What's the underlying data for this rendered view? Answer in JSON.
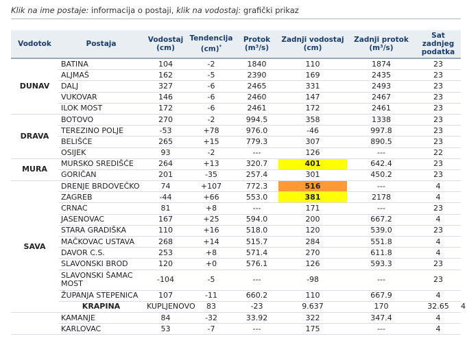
{
  "note": {
    "part1": "Klik na ime postaje:",
    "part2": " informacija o postaji, ",
    "part3": "klik na vodostaj:",
    "part4": " grafički prikaz"
  },
  "headers": {
    "vodotok": "Vodotok",
    "postaja": "Postaja",
    "vodostaj": "Vodostaj (cm)",
    "tendencija": "Tendencija (cm)",
    "tendencija_mark": "*",
    "protok": "Protok (m³/s)",
    "zadnji_vodostaj": "Zadnji vodostaj (cm)",
    "zadnji_protok": "Zadnji protok (m³/s)",
    "sat": "Sat zadnjeg podatka"
  },
  "colors": {
    "header_bg": "#e9eef3",
    "header_text": "#1a3d6e",
    "highlight_yellow": "#ffff00",
    "highlight_orange": "#ff9933"
  },
  "rows": [
    {
      "river": "DUNAV",
      "span": 5,
      "station": "BATINA",
      "v": "104",
      "t": "-2",
      "p": "1840",
      "zv": "110",
      "zp": "1874",
      "sat": "23"
    },
    {
      "station": "ALJMAŠ",
      "v": "162",
      "t": "-5",
      "p": "2390",
      "zv": "169",
      "zp": "2435",
      "sat": "23"
    },
    {
      "station": "DALJ",
      "v": "327",
      "t": "-6",
      "p": "2465",
      "zv": "331",
      "zp": "2493",
      "sat": "23"
    },
    {
      "station": "VUKOVAR",
      "v": "146",
      "t": "-6",
      "p": "2460",
      "zv": "147",
      "zp": "2467",
      "sat": "23"
    },
    {
      "station": "ILOK MOST",
      "v": "172",
      "t": "-6",
      "p": "2461",
      "zv": "172",
      "zp": "2461",
      "sat": "23"
    },
    {
      "river": "DRAVA",
      "span": 4,
      "station": "BOTOVO",
      "v": "270",
      "t": "-2",
      "p": "994.5",
      "zv": "358",
      "zp": "1338",
      "sat": "23"
    },
    {
      "station": "TEREZINO POLJE",
      "v": "-53",
      "t": "+78",
      "p": "976.0",
      "zv": "-46",
      "zp": "997.8",
      "sat": "23"
    },
    {
      "station": "BELIŠĆE",
      "v": "265",
      "t": "+15",
      "p": "779.3",
      "zv": "307",
      "zp": "890.5",
      "sat": "23"
    },
    {
      "station": "OSIJEK",
      "v": "93",
      "t": "-2",
      "p": "---",
      "zv": "126",
      "zp": "---",
      "sat": "22"
    },
    {
      "river": "MURA",
      "span": 2,
      "station": "MURSKO SREDIŠĆE",
      "v": "264",
      "t": "+13",
      "p": "320.7",
      "zv": "401",
      "zvHl": "yellow",
      "zp": "642.4",
      "sat": "23"
    },
    {
      "station": "GORIČAN",
      "v": "201",
      "t": "-35",
      "p": "257.4",
      "zv": "301",
      "zp": "450.2",
      "sat": "23"
    },
    {
      "river": "SAVA",
      "span": 11,
      "station": "DRENJE BRDOVEČKO",
      "v": "74",
      "t": "+107",
      "p": "772.3",
      "zv": "516",
      "zvHl": "orange",
      "zp": "---",
      "sat": "4"
    },
    {
      "station": "ZAGREB",
      "v": "-44",
      "t": "+66",
      "p": "553.0",
      "zv": "381",
      "zvHl": "yellow",
      "zp": "2178",
      "sat": "4"
    },
    {
      "station": "CRNAC",
      "v": "81",
      "t": "+8",
      "p": "---",
      "zv": "171",
      "zp": "---",
      "sat": "23"
    },
    {
      "station": "JASENOVAC",
      "v": "167",
      "t": "+25",
      "p": "594.0",
      "zv": "200",
      "zp": "667.2",
      "sat": "4"
    },
    {
      "station": "STARA GRADIŠKA",
      "v": "110",
      "t": "+16",
      "p": "518.0",
      "zv": "120",
      "zp": "539.0",
      "sat": "23"
    },
    {
      "station": "MAČKOVAC USTAVA",
      "v": "268",
      "t": "+14",
      "p": "515.7",
      "zv": "284",
      "zp": "551.8",
      "sat": "4"
    },
    {
      "station": "DAVOR C.S.",
      "v": "253",
      "t": "+8",
      "p": "571.4",
      "zv": "270",
      "zp": "611.8",
      "sat": "4"
    },
    {
      "station": "SLAVONSKI BROD",
      "v": "120",
      "t": "+0",
      "p": "576.1",
      "zv": "126",
      "zp": "593.3",
      "sat": "23"
    },
    {
      "station": "SLAVONSKI ŠAMAC MOST",
      "tall": true,
      "v": "-104",
      "t": "-5",
      "p": "---",
      "zv": "-98",
      "zp": "---",
      "sat": "23"
    },
    {
      "station": "ŽUPANJA STEPENICA",
      "v": "107",
      "t": "-11",
      "p": "660.2",
      "zv": "110",
      "zp": "667.9",
      "sat": "4"
    },
    {
      "river": "KRAPINA",
      "span": 1,
      "station": "KUPLJENOVO",
      "v": "83",
      "t": "-23",
      "p": "9.637",
      "zv": "170",
      "zp": "32.65",
      "sat": "4"
    },
    {
      "river": "",
      "span": 2,
      "station": "KAMANJE",
      "v": "84",
      "t": "-32",
      "p": "33.92",
      "zv": "322",
      "zp": "347.4",
      "sat": "4"
    },
    {
      "station": "KARLOVAC",
      "v": "53",
      "t": "-7",
      "p": "---",
      "zv": "175",
      "zp": "---",
      "sat": "4"
    }
  ]
}
